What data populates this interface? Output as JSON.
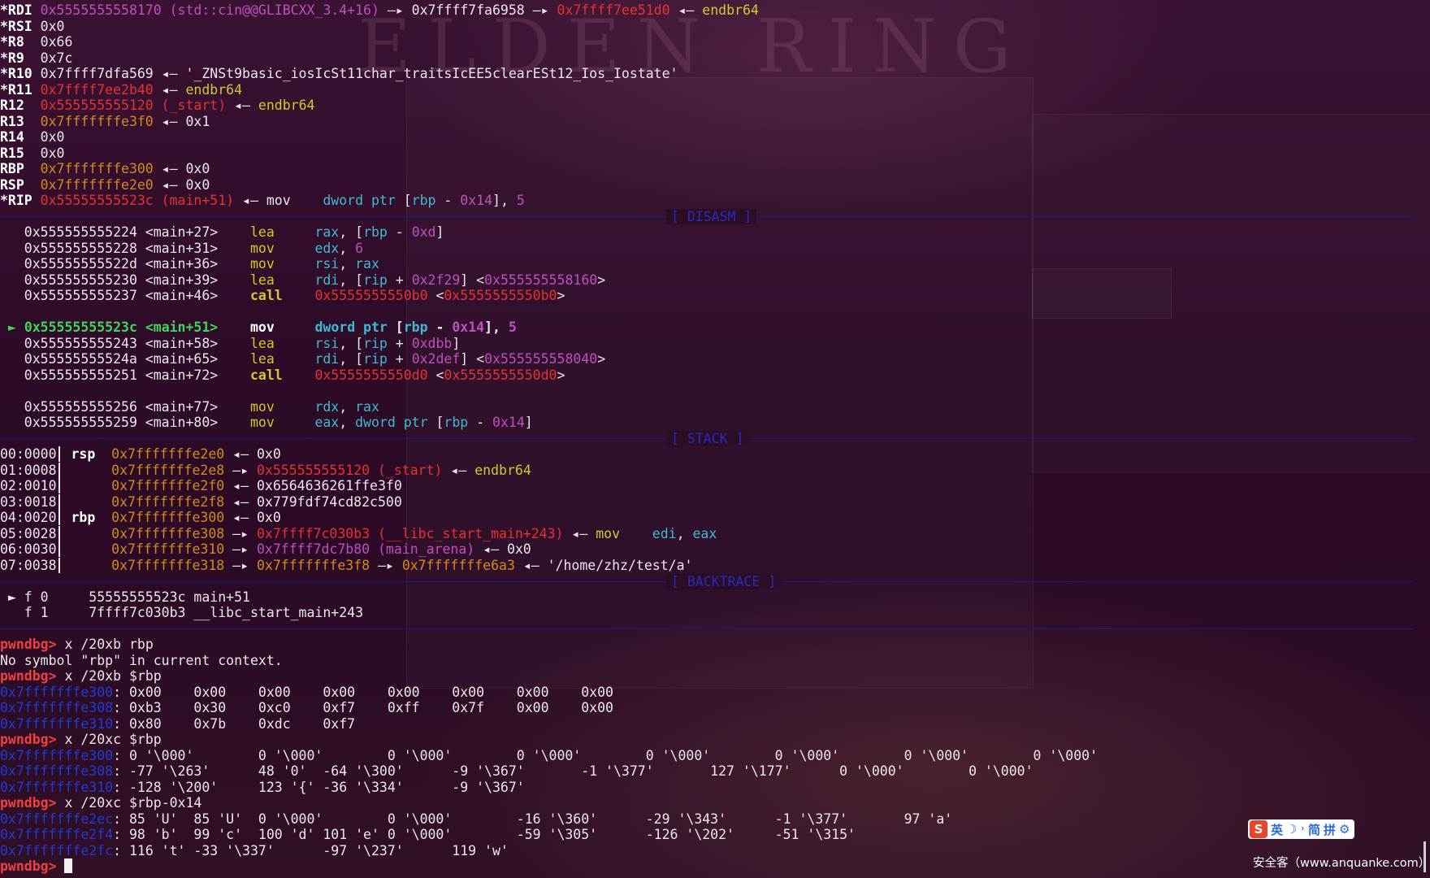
{
  "regs": [
    {
      "n": "*RDI",
      "v": "0x5555555558170",
      "c": "mag",
      "rest": [
        [
          "mag",
          " (std::cin@@GLIBCXX_3.4+16) "
        ],
        [
          "w",
          "—▸ 0x7ffff7fa6958 —▸ "
        ],
        [
          "red",
          "0x7ffff7ee51d0"
        ],
        [
          "w",
          " ◂— "
        ],
        [
          "yel",
          "endbr64"
        ]
      ]
    },
    {
      "n": "*RSI",
      "v": "0x0",
      "c": "w",
      "rest": []
    },
    {
      "n": "*R8",
      "v": "0x66",
      "c": "w",
      "rest": []
    },
    {
      "n": "*R9",
      "v": "0x7c",
      "c": "w",
      "rest": []
    },
    {
      "n": "*R10",
      "v": "0x7ffff7dfa569",
      "c": "w",
      "rest": [
        [
          "w",
          " ◂— '_ZNSt9basic_iosIcSt11char_traitsIcEE5clearESt12_Ios_Iostate'"
        ]
      ]
    },
    {
      "n": "*R11",
      "v": "0x7ffff7ee2b40",
      "c": "red",
      "rest": [
        [
          "w",
          " ◂— "
        ],
        [
          "yel",
          "endbr64"
        ]
      ]
    },
    {
      "n": "R12",
      "v": "0x555555555120",
      "c": "red",
      "rest": [
        [
          "red",
          " (_start)"
        ],
        [
          "w",
          " ◂— "
        ],
        [
          "yel",
          "endbr64"
        ]
      ]
    },
    {
      "n": "R13",
      "v": "0x7fffffffe3f0",
      "c": "org",
      "rest": [
        [
          "w",
          " ◂— 0x1"
        ]
      ]
    },
    {
      "n": "R14",
      "v": "0x0",
      "c": "w",
      "rest": []
    },
    {
      "n": "R15",
      "v": "0x0",
      "c": "w",
      "rest": []
    },
    {
      "n": "RBP",
      "v": "0x7fffffffe300",
      "c": "org",
      "rest": [
        [
          "w",
          " ◂— 0x0"
        ]
      ]
    },
    {
      "n": "RSP",
      "v": "0x7fffffffe2e0",
      "c": "org",
      "rest": [
        [
          "w",
          " ◂— 0x0"
        ]
      ]
    },
    {
      "n": "*RIP",
      "v": "0x55555555523c",
      "c": "red",
      "rest": [
        [
          "red",
          " (main+51)"
        ],
        [
          "w",
          " ◂— mov    "
        ],
        [
          "cyan",
          "dword ptr "
        ],
        [
          "w",
          "["
        ],
        [
          "cyan",
          "rbp"
        ],
        [
          "w",
          " - "
        ],
        [
          "mag",
          "0x14"
        ],
        [
          "w",
          "], "
        ],
        [
          "mag",
          "5"
        ]
      ]
    }
  ],
  "sections": {
    "disasm": "[ DISASM ]",
    "stack": "[ STACK ]",
    "backtrace": "[ BACKTRACE ]"
  },
  "disasm": [
    {
      "cur": false,
      "a": "0x555555555224 <main+27>",
      "m": "lea ",
      "ops": [
        [
          "cyan",
          "rax"
        ],
        [
          "w",
          ", ["
        ],
        [
          "cyan",
          "rbp"
        ],
        [
          "w",
          " - "
        ],
        [
          "mag",
          "0xd"
        ],
        [
          "w",
          "]"
        ]
      ]
    },
    {
      "cur": false,
      "a": "0x555555555228 <main+31>",
      "m": "mov ",
      "ops": [
        [
          "cyan",
          "edx"
        ],
        [
          "w",
          ", "
        ],
        [
          "mag",
          "6"
        ]
      ]
    },
    {
      "cur": false,
      "a": "0x55555555522d <main+36>",
      "m": "mov ",
      "ops": [
        [
          "cyan",
          "rsi"
        ],
        [
          "w",
          ", "
        ],
        [
          "cyan",
          "rax"
        ]
      ]
    },
    {
      "cur": false,
      "a": "0x555555555230 <main+39>",
      "m": "lea ",
      "ops": [
        [
          "cyan",
          "rdi"
        ],
        [
          "w",
          ", ["
        ],
        [
          "cyan",
          "rip"
        ],
        [
          "w",
          " + "
        ],
        [
          "mag",
          "0x2f29"
        ],
        [
          "w",
          "] <"
        ],
        [
          "mag",
          "0x555555558160"
        ],
        [
          "w",
          ">"
        ]
      ]
    },
    {
      "cur": false,
      "a": "0x555555555237 <main+46>",
      "m": "call",
      "ops": [
        [
          "red",
          "0x5555555550b0"
        ],
        [
          "w",
          " <"
        ],
        [
          "red",
          "0x5555555550b0"
        ],
        [
          "w",
          ">"
        ]
      ]
    },
    {
      "gap": true
    },
    {
      "cur": true,
      "a": "0x55555555523c <main+51>",
      "m": "mov ",
      "ops": [
        [
          "cyan",
          "dword ptr "
        ],
        [
          "w",
          "["
        ],
        [
          "cyan",
          "rbp"
        ],
        [
          "w",
          " - "
        ],
        [
          "mag",
          "0x14"
        ],
        [
          "w",
          "], "
        ],
        [
          "mag",
          "5"
        ]
      ]
    },
    {
      "cur": false,
      "a": "0x555555555243 <main+58>",
      "m": "lea ",
      "ops": [
        [
          "cyan",
          "rsi"
        ],
        [
          "w",
          ", ["
        ],
        [
          "cyan",
          "rip"
        ],
        [
          "w",
          " + "
        ],
        [
          "mag",
          "0xdbb"
        ],
        [
          "w",
          "]"
        ]
      ]
    },
    {
      "cur": false,
      "a": "0x55555555524a <main+65>",
      "m": "lea ",
      "ops": [
        [
          "cyan",
          "rdi"
        ],
        [
          "w",
          ", ["
        ],
        [
          "cyan",
          "rip"
        ],
        [
          "w",
          " + "
        ],
        [
          "mag",
          "0x2def"
        ],
        [
          "w",
          "] <"
        ],
        [
          "mag",
          "0x555555558040"
        ],
        [
          "w",
          ">"
        ]
      ]
    },
    {
      "cur": false,
      "a": "0x555555555251 <main+72>",
      "m": "call",
      "ops": [
        [
          "red",
          "0x5555555550d0"
        ],
        [
          "w",
          " <"
        ],
        [
          "red",
          "0x5555555550d0"
        ],
        [
          "w",
          ">"
        ]
      ]
    },
    {
      "gap": true
    },
    {
      "cur": false,
      "a": "0x555555555256 <main+77>",
      "m": "mov ",
      "ops": [
        [
          "cyan",
          "rdx"
        ],
        [
          "w",
          ", "
        ],
        [
          "cyan",
          "rax"
        ]
      ]
    },
    {
      "cur": false,
      "a": "0x555555555259 <main+80>",
      "m": "mov ",
      "ops": [
        [
          "cyan",
          "eax"
        ],
        [
          "w",
          ", "
        ],
        [
          "cyan",
          "dword ptr "
        ],
        [
          "w",
          "["
        ],
        [
          "cyan",
          "rbp"
        ],
        [
          "w",
          " - "
        ],
        [
          "mag",
          "0x14"
        ],
        [
          "w",
          "]"
        ]
      ]
    }
  ],
  "stack": [
    {
      "off": "00:0000",
      "reg": "rsp",
      "addr": "0x7fffffffe2e0",
      "rest": [
        [
          "w",
          " ◂— 0x0"
        ]
      ]
    },
    {
      "off": "01:0008",
      "reg": "",
      "addr": "0x7fffffffe2e8",
      "rest": [
        [
          "w",
          " —▸ "
        ],
        [
          "red",
          "0x555555555120"
        ],
        [
          "red",
          " (_start)"
        ],
        [
          "w",
          " ◂— "
        ],
        [
          "yel",
          "endbr64"
        ]
      ]
    },
    {
      "off": "02:0010",
      "reg": "",
      "addr": "0x7fffffffe2f0",
      "rest": [
        [
          "w",
          " ◂— 0x6564636261ffe3f0"
        ]
      ]
    },
    {
      "off": "03:0018",
      "reg": "",
      "addr": "0x7fffffffe2f8",
      "rest": [
        [
          "w",
          " ◂— 0x779fdf74cd82c500"
        ]
      ]
    },
    {
      "off": "04:0020",
      "reg": "rbp",
      "addr": "0x7fffffffe300",
      "rest": [
        [
          "w",
          " ◂— 0x0"
        ]
      ]
    },
    {
      "off": "05:0028",
      "reg": "",
      "addr": "0x7fffffffe308",
      "rest": [
        [
          "w",
          " —▸ "
        ],
        [
          "red",
          "0x7ffff7c030b3"
        ],
        [
          "red",
          " (__libc_start_main+243)"
        ],
        [
          "w",
          " ◂— "
        ],
        [
          "yel",
          "mov    "
        ],
        [
          "cyan",
          "edi"
        ],
        [
          "w",
          ", "
        ],
        [
          "cyan",
          "eax"
        ]
      ]
    },
    {
      "off": "06:0030",
      "reg": "",
      "addr": "0x7fffffffe310",
      "rest": [
        [
          "w",
          " —▸ "
        ],
        [
          "mag",
          "0x7ffff7dc7b80"
        ],
        [
          "mag",
          " (main_arena)"
        ],
        [
          "w",
          " ◂— 0x0"
        ]
      ]
    },
    {
      "off": "07:0038",
      "reg": "",
      "addr": "0x7fffffffe318",
      "rest": [
        [
          "w",
          " —▸ "
        ],
        [
          "org",
          "0x7fffffffe3f8"
        ],
        [
          "w",
          " —▸ "
        ],
        [
          "org",
          "0x7fffffffe6a3"
        ],
        [
          "w",
          " ◂— '/home/zhz/test/a'"
        ]
      ]
    }
  ],
  "backtrace": [
    {
      "cur": true,
      "f": "f 0",
      "addr": "55555555523c",
      "sym": "main+51"
    },
    {
      "cur": false,
      "f": "f 1",
      "addr": "7ffff7c030b3",
      "sym": "__libc_start_main+243"
    }
  ],
  "console": [
    [
      [
        "prom",
        "pwndbg> "
      ],
      [
        "w",
        "x /20xb rbp"
      ]
    ],
    [
      [
        "w",
        "No symbol \"rbp\" in current context."
      ]
    ],
    [
      [
        "prom",
        "pwndbg> "
      ],
      [
        "w",
        "x /20xb $rbp"
      ]
    ],
    [
      [
        "blue",
        "0x7fffffffe300"
      ],
      [
        "w",
        ": 0x00    0x00    0x00    0x00    0x00    0x00    0x00    0x00"
      ]
    ],
    [
      [
        "blue",
        "0x7fffffffe308"
      ],
      [
        "w",
        ": 0xb3    0x30    0xc0    0xf7    0xff    0x7f    0x00    0x00"
      ]
    ],
    [
      [
        "blue",
        "0x7fffffffe310"
      ],
      [
        "w",
        ": 0x80    0x7b    0xdc    0xf7"
      ]
    ],
    [
      [
        "prom",
        "pwndbg> "
      ],
      [
        "w",
        "x /20xc $rbp"
      ]
    ],
    [
      [
        "blue",
        "0x7fffffffe300"
      ],
      [
        "w",
        ": 0 '\\000'        0 '\\000'        0 '\\000'        0 '\\000'        0 '\\000'        0 '\\000'        0 '\\000'        0 '\\000'"
      ]
    ],
    [
      [
        "blue",
        "0x7fffffffe308"
      ],
      [
        "w",
        ": -77 '\\263'      48 '0'  -64 '\\300'      -9 '\\367'       -1 '\\377'       127 '\\177'      0 '\\000'        0 '\\000'"
      ]
    ],
    [
      [
        "blue",
        "0x7fffffffe310"
      ],
      [
        "w",
        ": -128 '\\200'     123 '{' -36 '\\334'      -9 '\\367'"
      ]
    ],
    [
      [
        "prom",
        "pwndbg> "
      ],
      [
        "w",
        "x /20xc $rbp-0x14"
      ]
    ],
    [
      [
        "blue",
        "0x7fffffffe2ec"
      ],
      [
        "w",
        ": 85 'U'  85 'U'  0 '\\000'        0 '\\000'        -16 '\\360'      -29 '\\343'      -1 '\\377'       97 'a'"
      ]
    ],
    [
      [
        "blue",
        "0x7fffffffe2f4"
      ],
      [
        "w",
        ": 98 'b'  99 'c'  100 'd' 101 'e' 0 '\\000'        -59 '\\305'      -126 '\\202'     -51 '\\315'"
      ]
    ],
    [
      [
        "blue",
        "0x7fffffffe2fc"
      ],
      [
        "w",
        ": 116 't' -33 '\\337'      -97 '\\237'      119 'w'"
      ]
    ]
  ],
  "prompt": "pwndbg> ",
  "ime": {
    "labels": [
      "英",
      "☽",
      "˒",
      "简",
      "拼",
      "⚙"
    ]
  },
  "watermark": "安全客（www.anquanke.com）"
}
